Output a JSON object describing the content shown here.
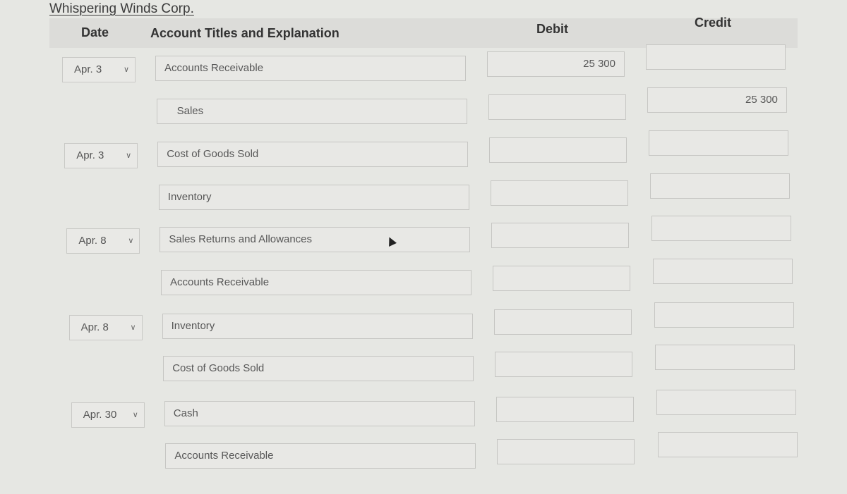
{
  "company": "Whispering Winds Corp.",
  "headers": {
    "date": "Date",
    "account": "Account Titles and Explanation",
    "debit": "Debit",
    "credit": "Credit"
  },
  "rows": [
    {
      "date": "Apr. 3",
      "account": "Accounts Receivable",
      "debit": "25 300",
      "credit": ""
    },
    {
      "date": "",
      "account": "Sales",
      "debit": "",
      "credit": "25 300"
    },
    {
      "date": "Apr. 3",
      "account": "Cost of Goods Sold",
      "debit": "",
      "credit": ""
    },
    {
      "date": "",
      "account": "Inventory",
      "debit": "",
      "credit": ""
    },
    {
      "date": "Apr. 8",
      "account": "Sales Returns and Allowances",
      "debit": "",
      "credit": ""
    },
    {
      "date": "",
      "account": "Accounts Receivable",
      "debit": "",
      "credit": ""
    },
    {
      "date": "Apr. 8",
      "account": "Inventory",
      "debit": "",
      "credit": ""
    },
    {
      "date": "",
      "account": "Cost of Goods Sold",
      "debit": "",
      "credit": ""
    },
    {
      "date": "Apr. 30",
      "account": "Cash",
      "debit": "",
      "credit": ""
    },
    {
      "date": "",
      "account": "Accounts Receivable",
      "debit": "",
      "credit": ""
    }
  ],
  "icons": {
    "dropdown": "chevron-down-icon",
    "cursor": "mouse-pointer-icon"
  }
}
